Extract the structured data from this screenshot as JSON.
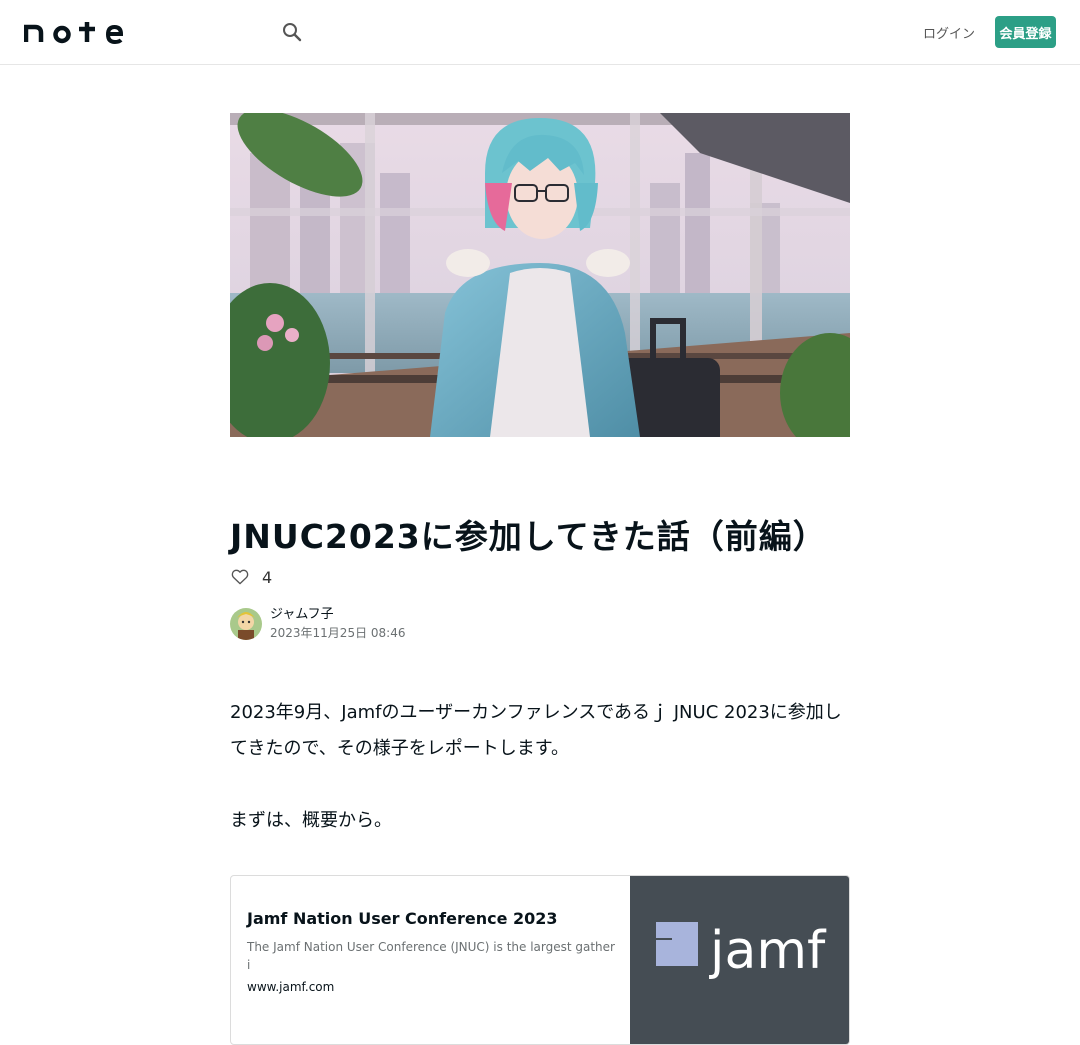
{
  "header": {
    "logo_text": "note",
    "login_label": "ログイン",
    "signup_label": "会員登録"
  },
  "article": {
    "title": "JNUC2023に参加してきた話（前編）",
    "like_count": "4",
    "author_name": "ジャムフ子",
    "date": "2023年11月25日 08:46",
    "paragraph1": "2023年9月、Jamfのユーザーカンファレンスであるｊ JNUC 2023に参加してきたので、その様子をレポートします。",
    "paragraph2": "まずは、概要から。"
  },
  "link_card": {
    "title": "Jamf Nation User Conference 2023",
    "description": "The Jamf Nation User Conference (JNUC) is the largest gatheri",
    "domain": "www.jamf.com",
    "thumb_logo_text": "jamf"
  },
  "colors": {
    "accent": "#2c9f86",
    "jamf_bg": "#454d54"
  },
  "icons": [
    "search-icon",
    "heart-icon"
  ]
}
